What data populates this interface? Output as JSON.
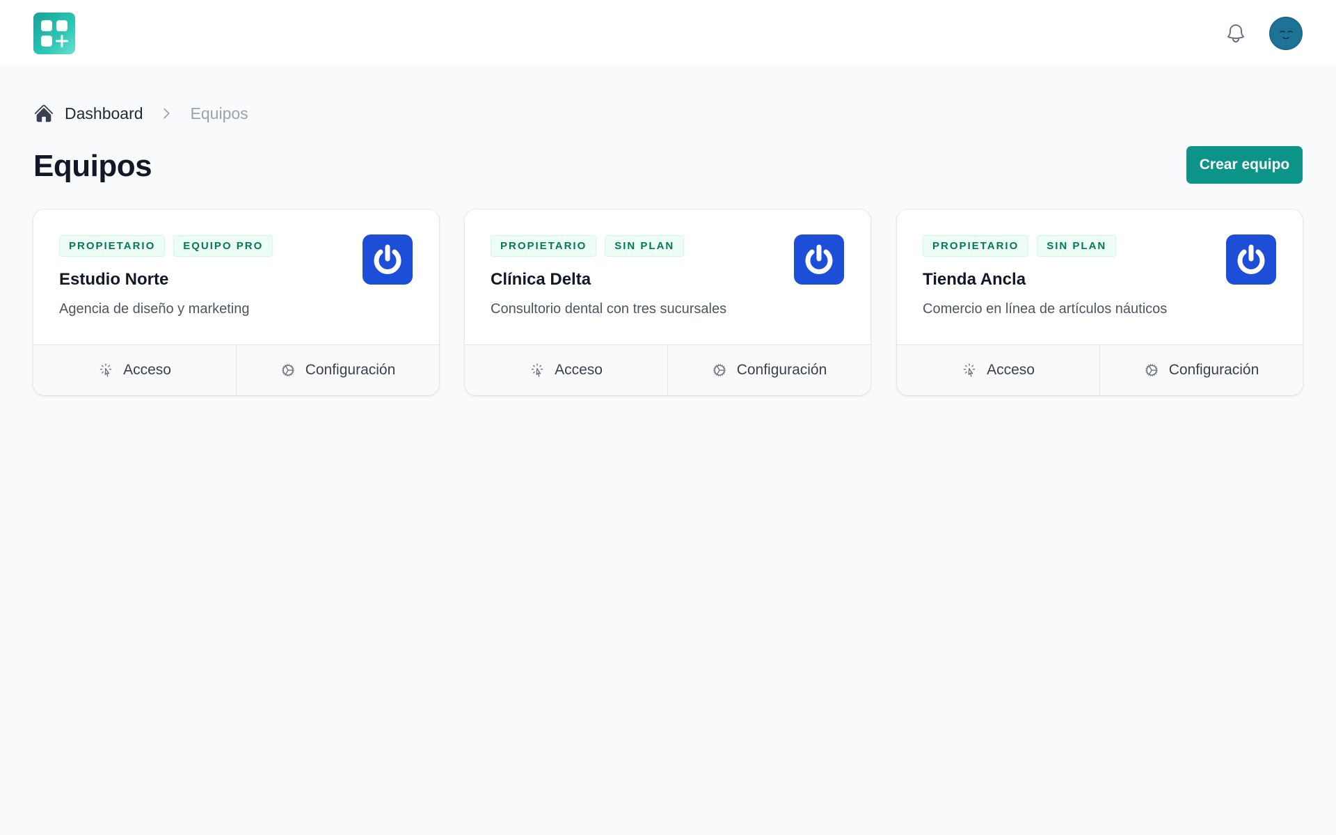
{
  "header": {
    "logo_icon": "apps-plus-logo-icon",
    "notification_icon": "bell-icon",
    "avatar_icon": "user-avatar"
  },
  "breadcrumb": {
    "home_icon": "home-icon",
    "items": [
      {
        "label": "Dashboard"
      },
      {
        "label": "Equipos"
      }
    ]
  },
  "page": {
    "title": "Equipos",
    "create_button_label": "Crear equipo"
  },
  "colors": {
    "accent": "#0d9488",
    "badge_text": "#047857",
    "team_icon_bg": "#1d4ed8"
  },
  "teams": [
    {
      "badges": [
        "PROPIETARIO",
        "EQUIPO PRO"
      ],
      "name": "Estudio Norte",
      "description": "Agencia de diseño y marketing",
      "icon": "power-icon",
      "actions": {
        "access_label": "Acceso",
        "settings_label": "Configuración"
      }
    },
    {
      "badges": [
        "PROPIETARIO",
        "SIN PLAN"
      ],
      "name": "Clínica Delta",
      "description": "Consultorio dental con tres sucursales",
      "icon": "power-icon",
      "actions": {
        "access_label": "Acceso",
        "settings_label": "Configuración"
      }
    },
    {
      "badges": [
        "PROPIETARIO",
        "SIN PLAN"
      ],
      "name": "Tienda Ancla",
      "description": "Comercio en línea de artículos náuticos",
      "icon": "power-icon",
      "actions": {
        "access_label": "Acceso",
        "settings_label": "Configuración"
      }
    }
  ]
}
